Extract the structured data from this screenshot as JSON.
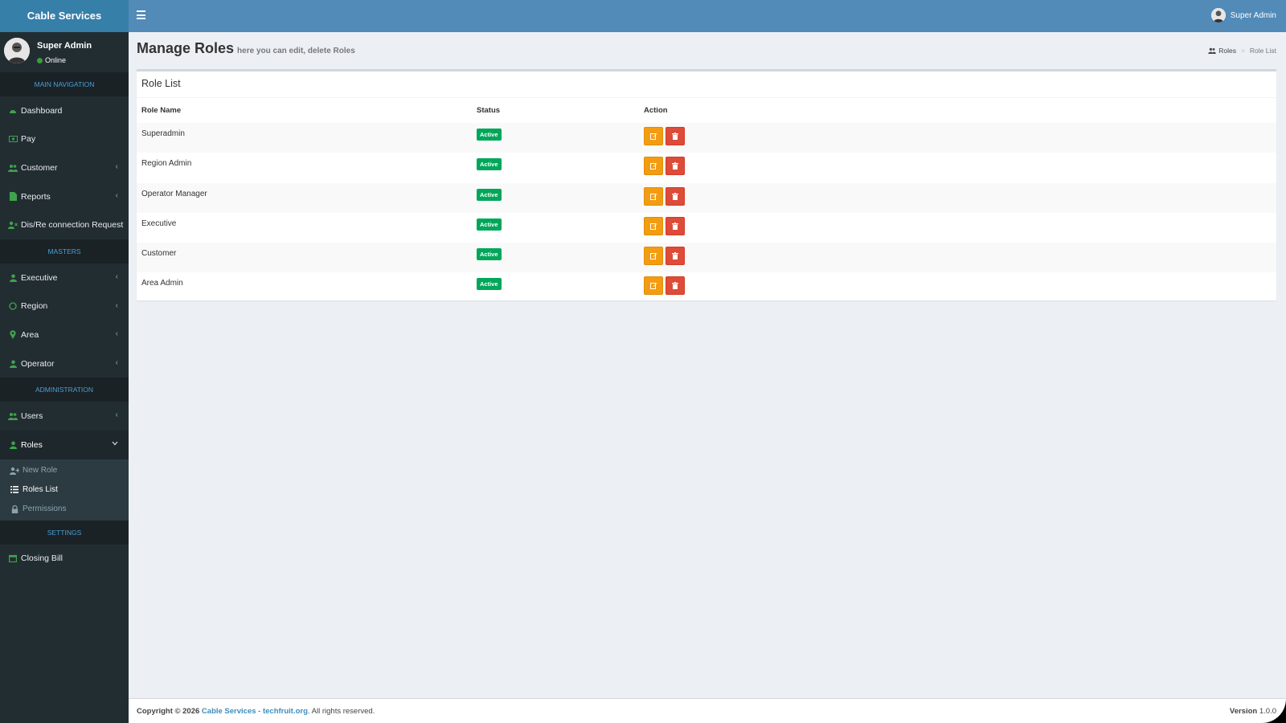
{
  "app": {
    "brand": "Cable Services"
  },
  "user": {
    "name": "Super Admin",
    "status": "Online"
  },
  "sidebar": {
    "headers": {
      "main": "MAIN NAVIGATION",
      "masters": "MASTERS",
      "admin": "ADMINISTRATION",
      "settings": "SETTINGS"
    },
    "items": {
      "dashboard": "Dashboard",
      "pay": "Pay",
      "customer": "Customer",
      "reports": "Reports",
      "disre": "Dis/Re connection Request",
      "executive": "Executive",
      "region": "Region",
      "area": "Area",
      "operator": "Operator",
      "users": "Users",
      "roles": "Roles",
      "closing_bill": "Closing Bill"
    },
    "roles_submenu": {
      "new_role": "New Role",
      "roles_list": "Roles List",
      "permissions": "Permissions"
    }
  },
  "header": {
    "user_name": "Super Admin"
  },
  "page": {
    "title": "Manage Roles",
    "subtitle": "here you can edit, delete Roles",
    "breadcrumb": {
      "root": "Roles",
      "current": "Role List"
    }
  },
  "role_list": {
    "title": "Role List",
    "columns": [
      "Role Name",
      "Status",
      "Action"
    ],
    "rows": [
      {
        "name": "Superadmin",
        "status": "Active"
      },
      {
        "name": "Region Admin",
        "status": "Active"
      },
      {
        "name": "Operator Manager",
        "status": "Active"
      },
      {
        "name": "Executive",
        "status": "Active"
      },
      {
        "name": "Customer",
        "status": "Active"
      },
      {
        "name": "Area Admin",
        "status": "Active"
      }
    ]
  },
  "footer": {
    "copyright": "Copyright © 2026",
    "link_text": "Cable Services - techfruit.org",
    "rights": ". All rights reserved.",
    "version_label": "Version",
    "version": "1.0.0"
  },
  "colors": {
    "header": "#528ab8",
    "logo": "#367fa9",
    "sidebar": "#222d32",
    "active_badge": "#00a65a",
    "edit_button": "#f39c12",
    "delete_button": "#dd4b39",
    "sidebar_icon": "#3fa34d"
  }
}
